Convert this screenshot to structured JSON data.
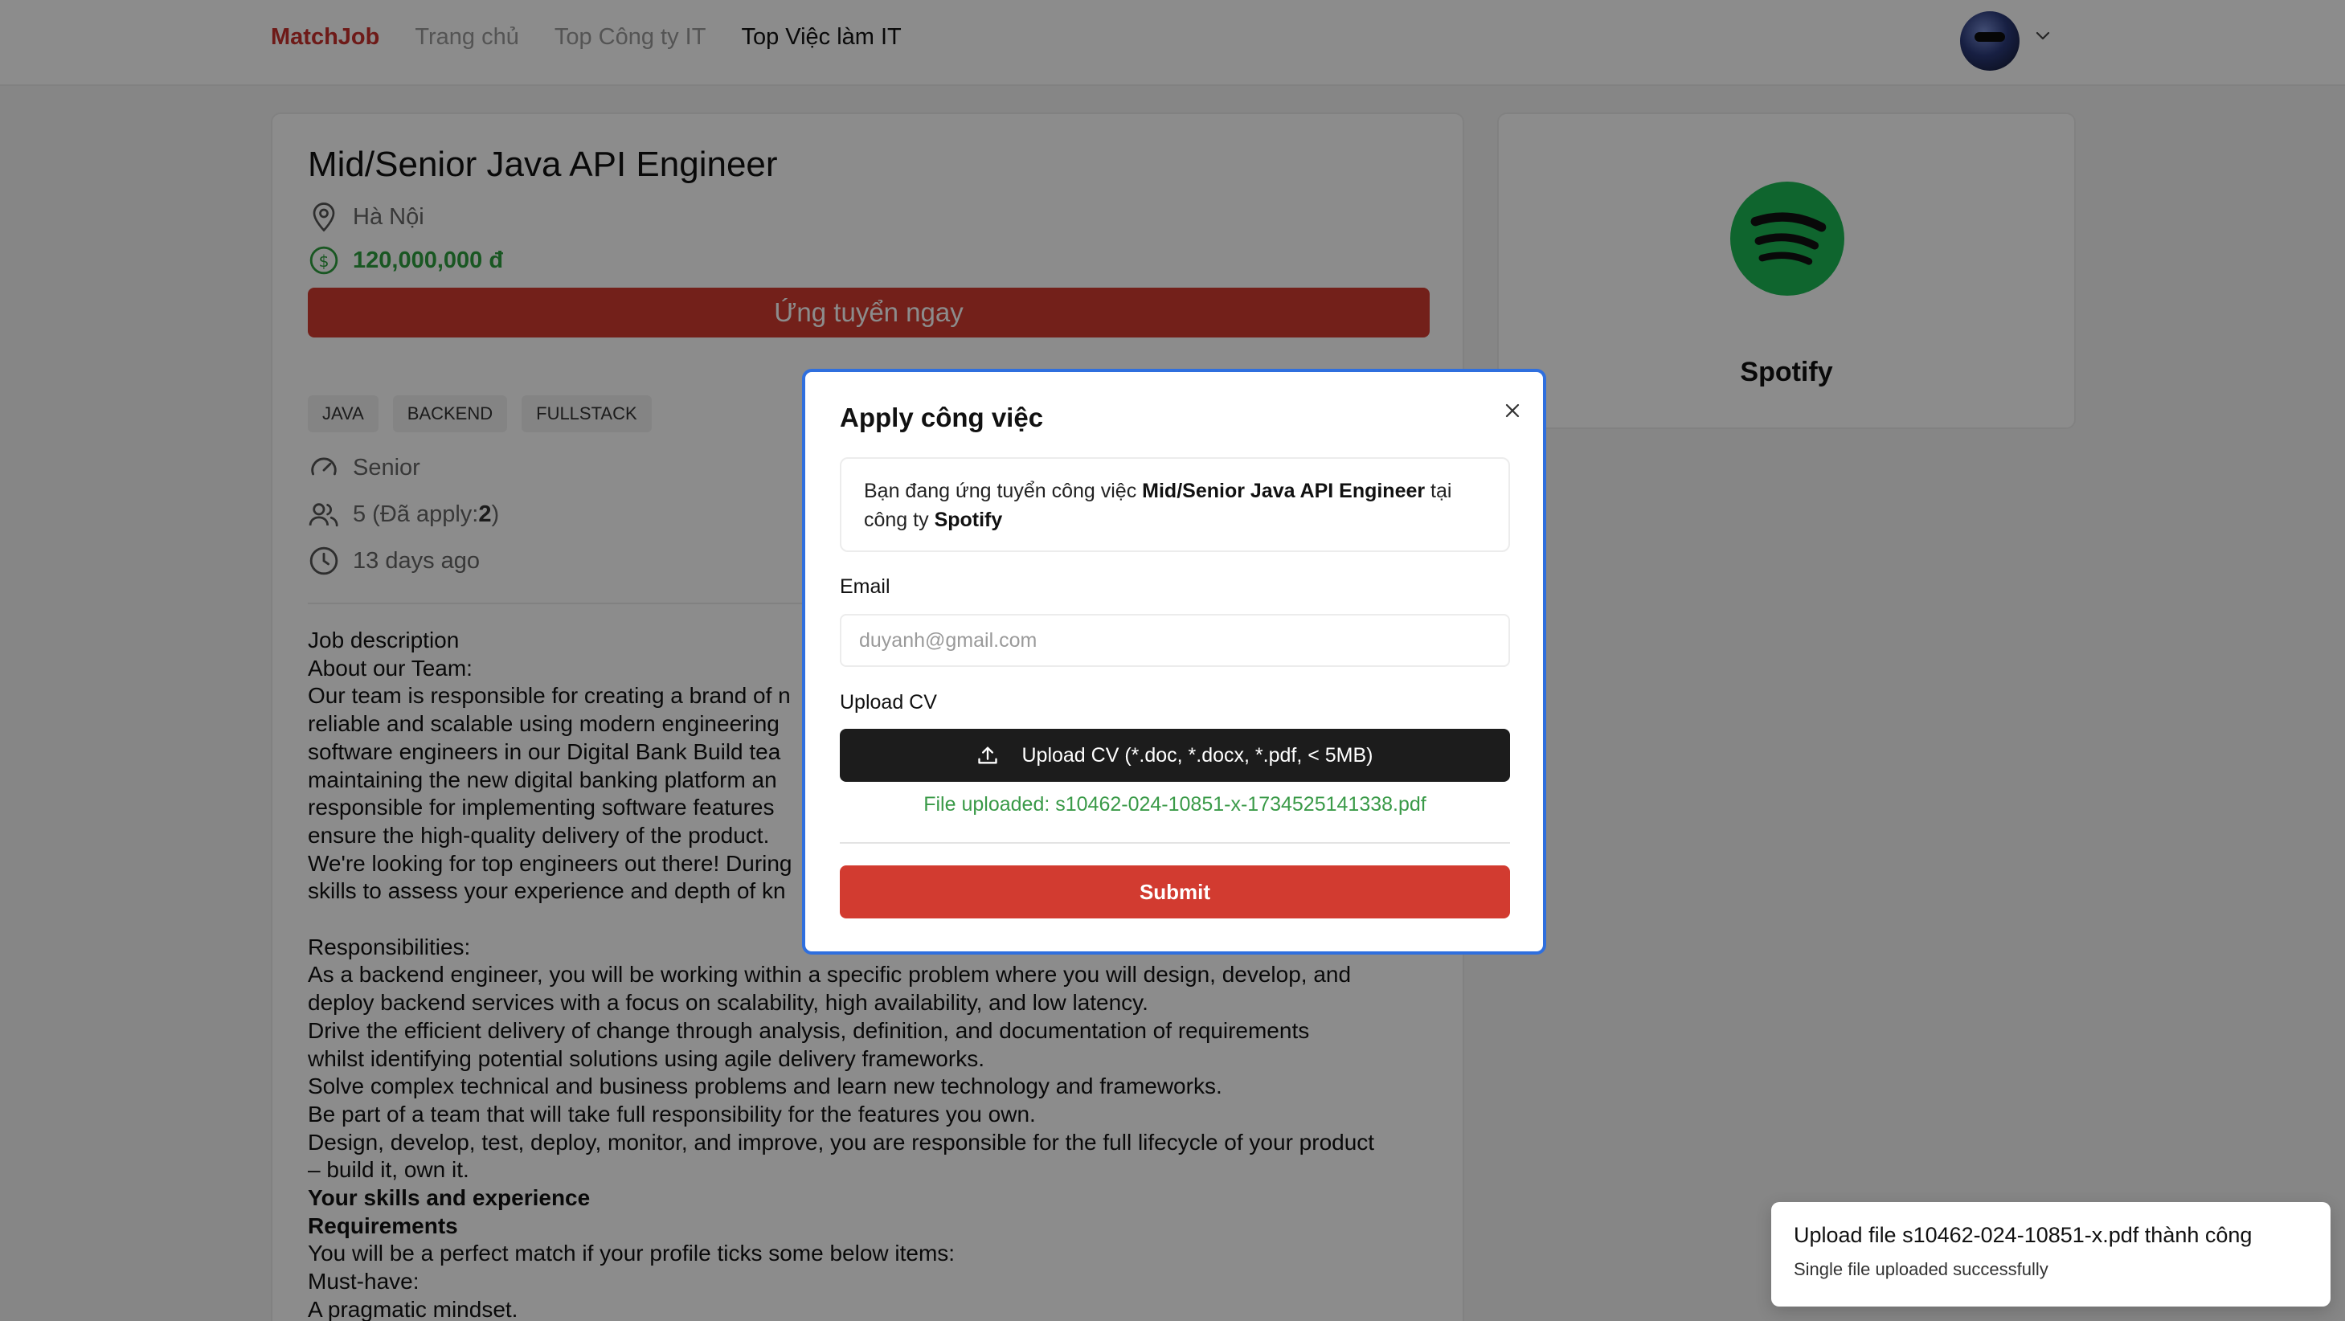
{
  "header": {
    "logo": "MatchJob",
    "nav": [
      "Trang chủ",
      "Top Công ty IT",
      "Top Việc làm IT"
    ]
  },
  "job": {
    "title": "Mid/Senior Java API Engineer",
    "location": "Hà Nội",
    "salary": "120,000,000 đ",
    "apply_label": "Ứng tuyển ngay",
    "tags": [
      "JAVA",
      "BACKEND",
      "FULLSTACK"
    ],
    "level": "Senior",
    "quantity_prefix": "5 (Đã apply: ",
    "quantity_applied": "2",
    "quantity_suffix": ")",
    "posted": "13 days ago",
    "description": [
      {
        "text": "Job description",
        "bold": false
      },
      {
        "text": "About our Team:",
        "bold": false
      },
      {
        "text": "Our team is responsible for creating a brand of n",
        "bold": false
      },
      {
        "text": "reliable and scalable using modern engineering",
        "bold": false
      },
      {
        "text": "software engineers in our Digital Bank Build tea",
        "bold": false
      },
      {
        "text": "maintaining the new digital banking platform an",
        "bold": false
      },
      {
        "text": "responsible for implementing software features",
        "bold": false
      },
      {
        "text": "ensure the high-quality delivery of the product.",
        "bold": false
      },
      {
        "text": "We're looking for top engineers out there! During",
        "bold": false
      },
      {
        "text": "skills to assess your experience and depth of kn",
        "bold": false
      },
      {
        "text": "",
        "bold": false
      },
      {
        "text": "Responsibilities:",
        "bold": false
      },
      {
        "text": "As a backend engineer, you will be working within a specific problem where you will design, develop, and",
        "bold": false
      },
      {
        "text": "deploy backend services with a focus on scalability, high availability, and low latency.",
        "bold": false
      },
      {
        "text": "Drive the efficient delivery of change through analysis, definition, and documentation of requirements",
        "bold": false
      },
      {
        "text": "whilst identifying potential solutions using agile delivery frameworks.",
        "bold": false
      },
      {
        "text": "Solve complex technical and business problems and learn new technology and frameworks.",
        "bold": false
      },
      {
        "text": "Be part of a team that will take full responsibility for the features you own.",
        "bold": false
      },
      {
        "text": "Design, develop, test, deploy, monitor, and improve, you are responsible for the full lifecycle of your product",
        "bold": false
      },
      {
        "text": "– build it, own it.",
        "bold": false
      },
      {
        "text": "Your skills and experience",
        "bold": true
      },
      {
        "text": "Requirements",
        "bold": true
      },
      {
        "text": "You will be a perfect match if your profile ticks some below items:",
        "bold": false
      },
      {
        "text": "Must-have:",
        "bold": false
      },
      {
        "text": "A pragmatic mindset.",
        "bold": false
      }
    ]
  },
  "company": {
    "name": "Spotify",
    "brand_color": "#1DB954"
  },
  "modal": {
    "title": "Apply công việc",
    "info_prefix": "Bạn đang ứng tuyển công việc ",
    "info_job": "Mid/Senior Java API Engineer",
    "info_middle": " tại công ty ",
    "info_company": "Spotify",
    "email_label": "Email",
    "email_placeholder": "duyanh@gmail.com",
    "upload_label": "Upload CV",
    "upload_button": "Upload CV (*.doc, *.docx, *.pdf, < 5MB)",
    "upload_status": "File uploaded: s10462-024-10851-x-1734525141338.pdf",
    "submit_label": "Submit"
  },
  "toast": {
    "title": "Upload file s10462-024-10851-x.pdf thành công",
    "message": "Single file uploaded successfully"
  },
  "colors": {
    "accent": "#d23b30",
    "success": "#3a9a48",
    "modal_border": "#2f6fde"
  }
}
